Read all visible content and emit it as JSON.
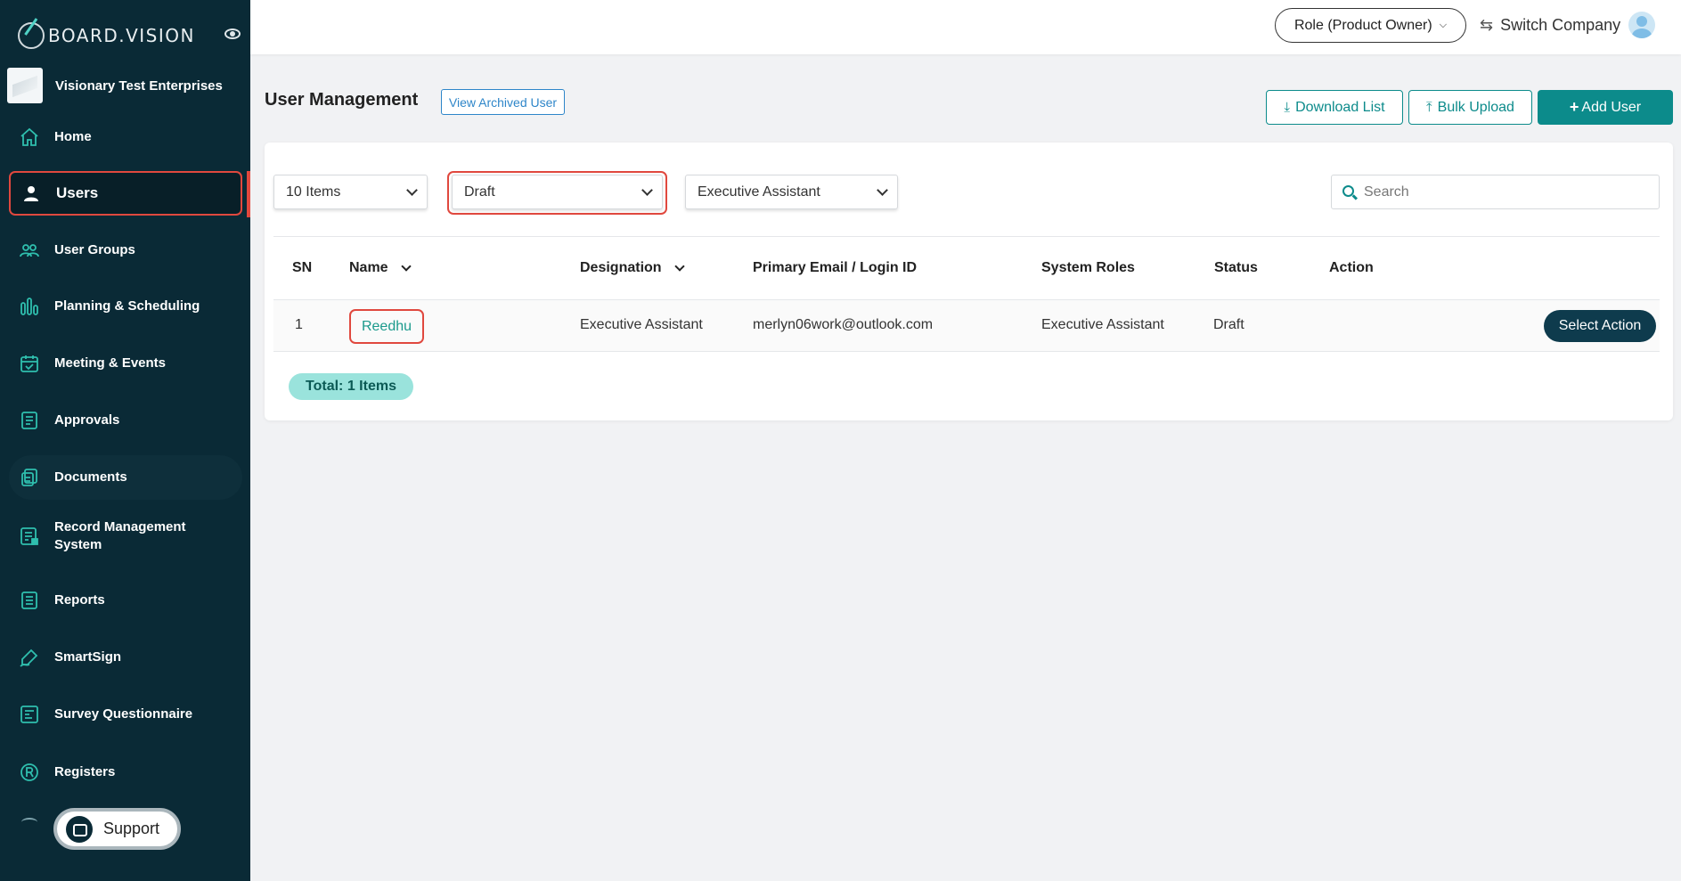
{
  "brand": {
    "logo_text": "BOARD.VISION"
  },
  "organization": {
    "name": "Visionary Test Enterprises"
  },
  "sidebar": {
    "items": [
      {
        "label": "Home",
        "icon": "home-icon"
      },
      {
        "label": "Users",
        "icon": "user-icon",
        "active": true
      },
      {
        "label": "User Groups",
        "icon": "user-group-icon"
      },
      {
        "label": "Planning & Scheduling",
        "icon": "planning-icon"
      },
      {
        "label": "Meeting & Events",
        "icon": "calendar-icon"
      },
      {
        "label": "Approvals",
        "icon": "approval-icon"
      },
      {
        "label": "Documents",
        "icon": "documents-icon"
      },
      {
        "label": "Record Management System",
        "icon": "records-icon"
      },
      {
        "label": "Reports",
        "icon": "reports-icon"
      },
      {
        "label": "SmartSign",
        "icon": "pen-icon"
      },
      {
        "label": "Survey Questionnaire",
        "icon": "survey-icon"
      },
      {
        "label": "Registers",
        "icon": "registered-icon"
      }
    ],
    "support_label": "Support"
  },
  "topbar": {
    "role_label": "Role (Product Owner)",
    "switch_company_label": "Switch Company"
  },
  "header": {
    "title": "User Management",
    "view_archived_label": "View Archived User",
    "download_label": "Download List",
    "bulk_upload_label": "Bulk Upload",
    "add_user_label": "Add User"
  },
  "filters": {
    "items_per_page": "10 Items",
    "status": "Draft",
    "designation": "Executive Assistant",
    "search_placeholder": "Search"
  },
  "table": {
    "columns": [
      "SN",
      "Name",
      "Designation",
      "Primary Email / Login ID",
      "System Roles",
      "Status",
      "Action"
    ],
    "rows": [
      {
        "sn": "1",
        "name": "Reedhu",
        "designation": "Executive Assistant",
        "email": "merlyn06work@outlook.com",
        "system_roles": "Executive Assistant",
        "status": "Draft",
        "action_label": "Select Action"
      }
    ]
  },
  "footer": {
    "total_label": "Total: 1 Items"
  },
  "colors": {
    "sidebar_bg": "#0a2a36",
    "accent_teal": "#0c8b8b",
    "highlight_red": "#e0483e",
    "badge_bg": "#9ae3dc",
    "link_blue": "#2e86c9"
  }
}
